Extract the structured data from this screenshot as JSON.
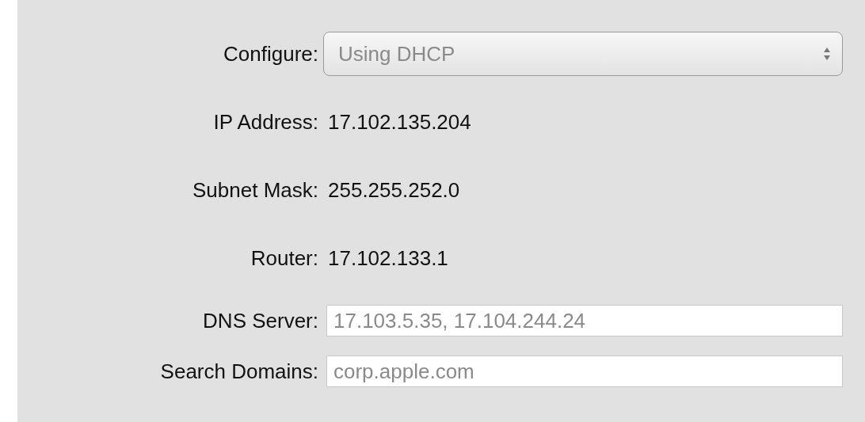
{
  "configure": {
    "label": "Configure:",
    "value": "Using DHCP",
    "disabled": true
  },
  "info_rows": [
    {
      "label": "IP Address:",
      "value": "17.102.135.204"
    },
    {
      "label": "Subnet Mask:",
      "value": "255.255.252.0"
    },
    {
      "label": "Router:",
      "value": "17.102.133.1"
    }
  ],
  "fields": [
    {
      "label": "DNS Server:",
      "placeholder": "17.103.5.35, 17.104.244.24"
    },
    {
      "label": "Search Domains:",
      "placeholder": "corp.apple.com"
    }
  ]
}
